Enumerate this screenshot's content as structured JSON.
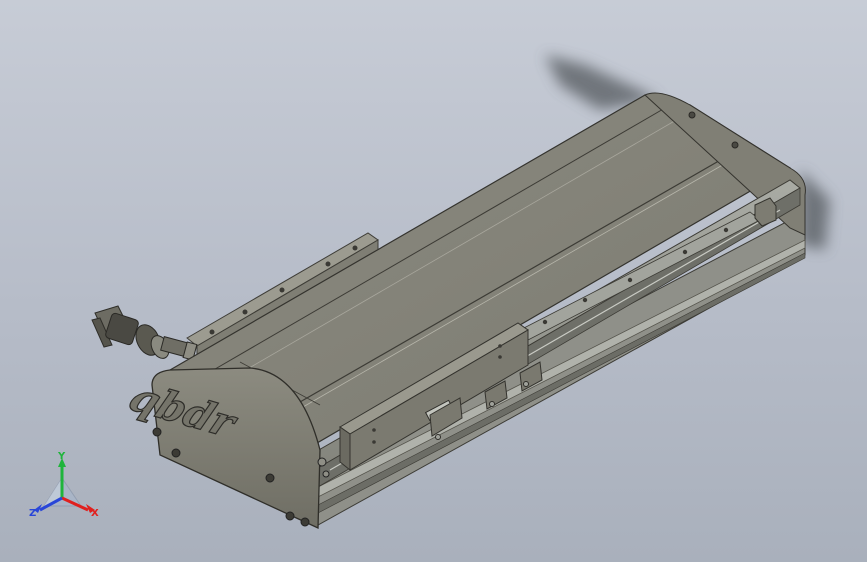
{
  "viewport": {
    "background_top": "#c7ccd6",
    "background_bottom": "#a9b0bc"
  },
  "model": {
    "logo_text": "qbdr",
    "body_color": "#7e7d71",
    "top_color": "#8a8a7f",
    "rail_color": "#9a9c95",
    "cable_color": "#3c3b35"
  },
  "triad": {
    "x_label": "X",
    "y_label": "Y",
    "z_label": "Z",
    "x_color": "#e0201e",
    "y_color": "#1fb43b",
    "z_color": "#2946d8"
  }
}
